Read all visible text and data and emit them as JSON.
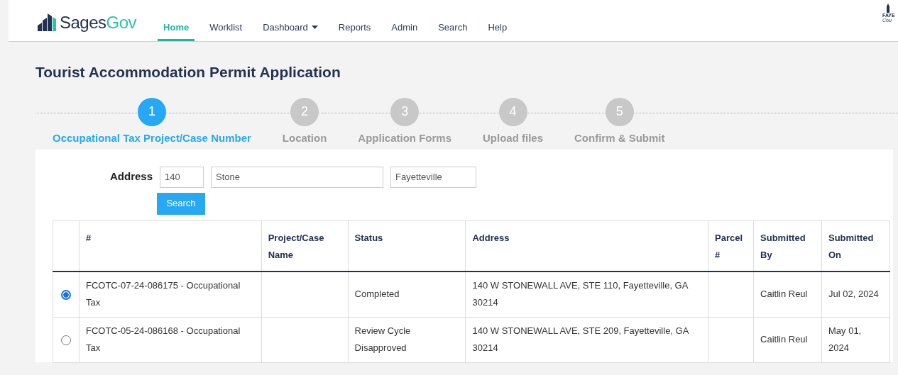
{
  "brand": {
    "primary": "Sages",
    "accent": "Gov"
  },
  "nav": [
    {
      "label": "Home",
      "selected": true
    },
    {
      "label": "Worklist",
      "selected": false
    },
    {
      "label": "Dashboard",
      "selected": false,
      "dropdown": true
    },
    {
      "label": "Reports",
      "selected": false
    },
    {
      "label": "Admin",
      "selected": false
    },
    {
      "label": "Search",
      "selected": false
    },
    {
      "label": "Help",
      "selected": false
    }
  ],
  "county_logo": {
    "texts": [
      "FAYE",
      "Cou"
    ]
  },
  "title": "Tourist Accommodation Permit Application",
  "steps": [
    {
      "number": "1",
      "label": "Occupational Tax Project/Case Number",
      "selected": true
    },
    {
      "number": "2",
      "label": "Location",
      "selected": false
    },
    {
      "number": "3",
      "label": "Application Forms",
      "selected": false
    },
    {
      "number": "4",
      "label": "Upload files",
      "selected": false
    },
    {
      "number": "5",
      "label": "Confirm & Submit",
      "selected": false
    }
  ],
  "address_form": {
    "label": "Address",
    "fields": [
      {
        "value": "140"
      },
      {
        "value": "Stone"
      },
      {
        "value": "Fayetteville"
      }
    ],
    "button": "Search"
  },
  "table": {
    "columns": [
      "#",
      "Project/Case Name",
      "Status",
      "Address",
      "Parcel #",
      "Submitted By",
      "Submitted On"
    ],
    "rows": [
      {
        "selected": true,
        "cells": [
          "FCOTC-07-24-086175 - Occupational Tax",
          "",
          "Completed",
          "140 W STONEWALL AVE, STE 110, Fayetteville, GA 30214",
          "",
          "Caitlin Reul",
          "Jul 02, 2024"
        ]
      },
      {
        "selected": false,
        "cells": [
          "FCOTC-05-24-086168 - Occupational Tax",
          "",
          "Review Cycle Disapproved",
          "140 W STONEWALL AVE, STE 209, Fayetteville, GA 30214",
          "",
          "Caitlin Reul",
          "May 01, 2024"
        ]
      }
    ]
  }
}
